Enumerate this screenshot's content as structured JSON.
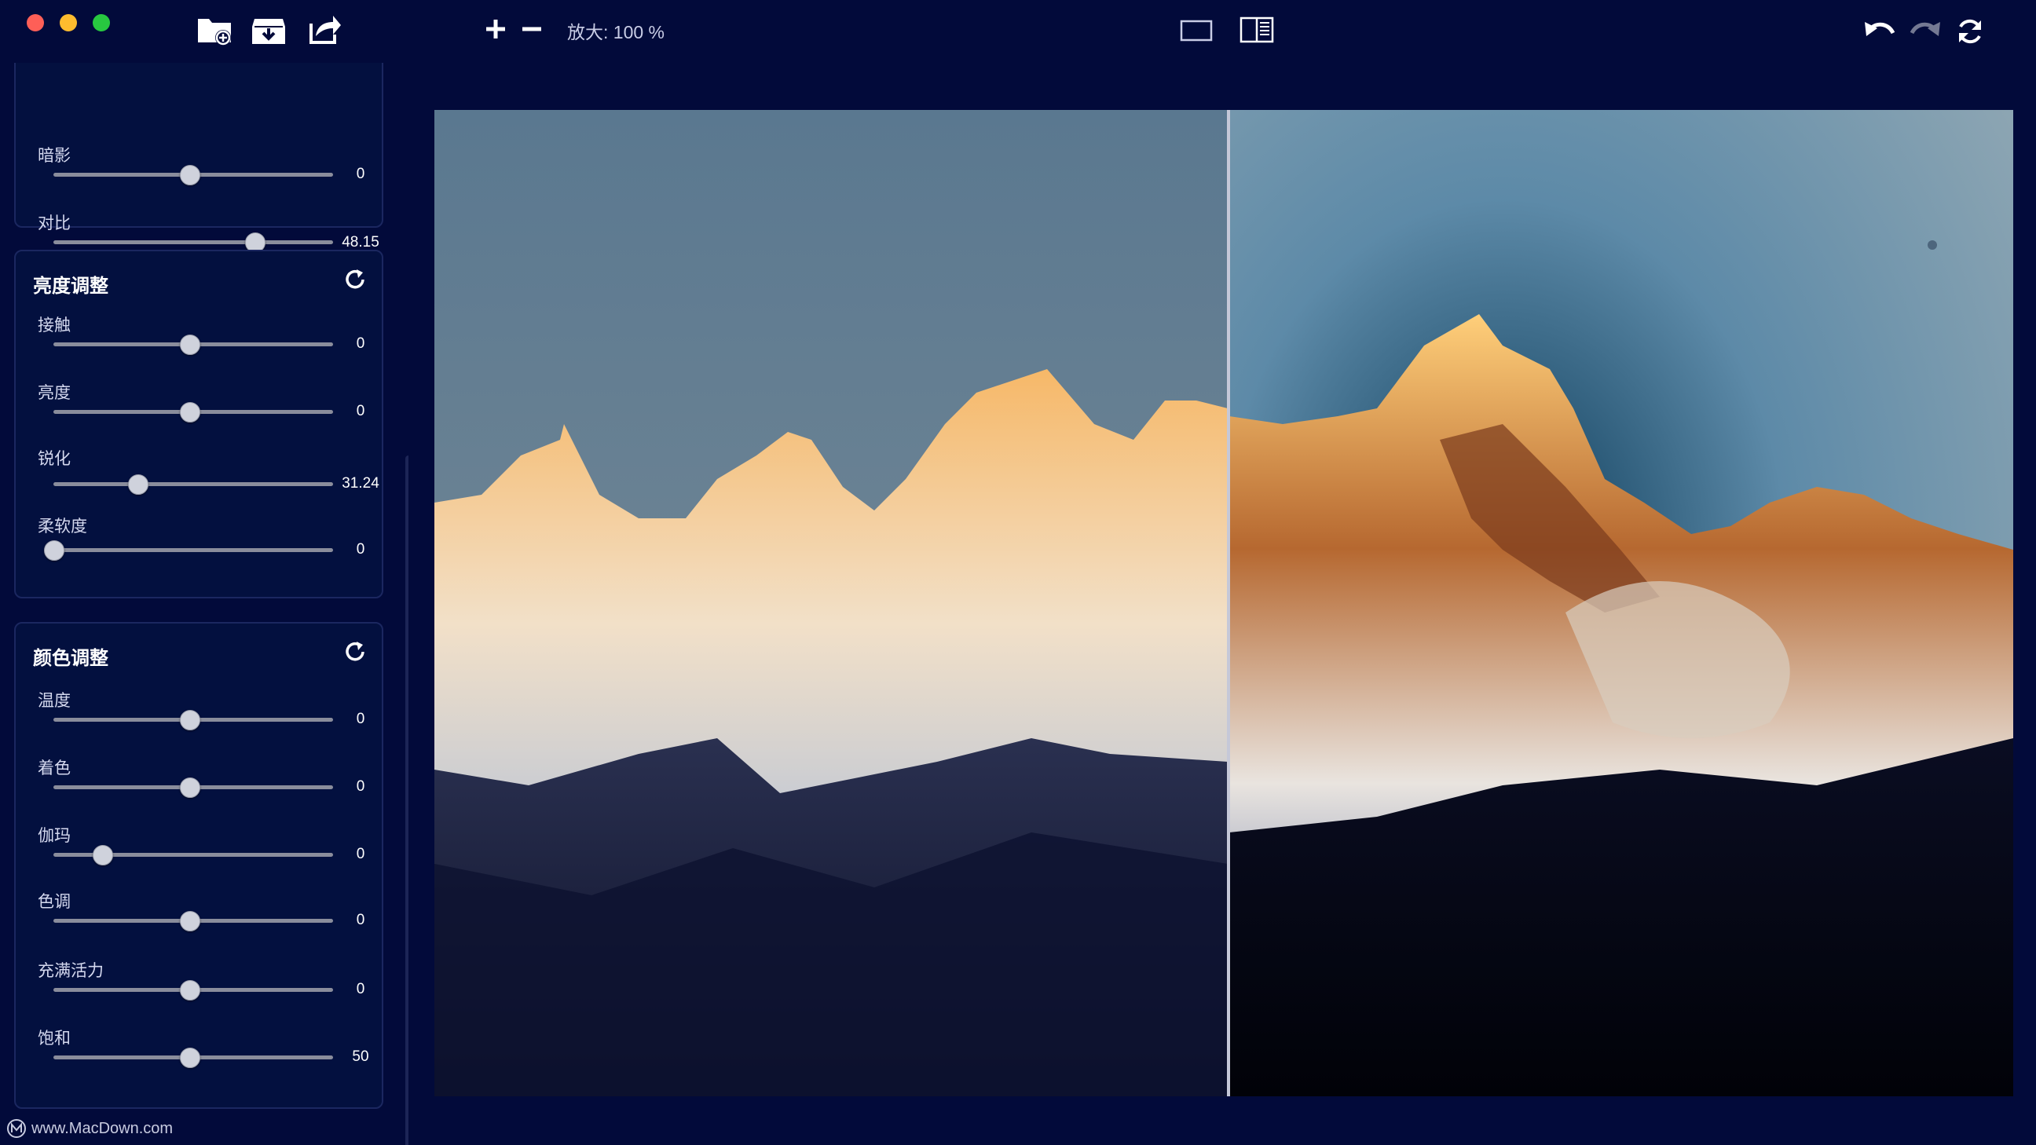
{
  "toolbar": {
    "zoom_label": "放大: 100 %",
    "icons": [
      "add-folder-icon",
      "save-icon",
      "share-icon",
      "zoom-in-icon",
      "zoom-out-icon",
      "single-view-icon",
      "split-view-icon",
      "undo-icon",
      "redo-icon",
      "refresh-icon"
    ]
  },
  "panels": {
    "tone": {
      "sliders": [
        {
          "label": "暗影",
          "value": "0",
          "fraction": 0.5
        },
        {
          "label": "对比",
          "value": "48.15",
          "fraction": 0.74
        }
      ]
    },
    "brightness": {
      "title": "亮度调整",
      "sliders": [
        {
          "label": "接触",
          "value": "0",
          "fraction": 0.5
        },
        {
          "label": "亮度",
          "value": "0",
          "fraction": 0.5
        },
        {
          "label": "锐化",
          "value": "31.24",
          "fraction": 0.31
        },
        {
          "label": "柔软度",
          "value": "0",
          "fraction": 0.0
        }
      ]
    },
    "color": {
      "title": "颜色调整",
      "sliders": [
        {
          "label": "温度",
          "value": "0",
          "fraction": 0.5
        },
        {
          "label": "着色",
          "value": "0",
          "fraction": 0.5
        },
        {
          "label": "伽玛",
          "value": "0",
          "fraction": 0.18
        },
        {
          "label": "色调",
          "value": "0",
          "fraction": 0.5
        },
        {
          "label": "充满活力",
          "value": "0",
          "fraction": 0.5
        },
        {
          "label": "饱和",
          "value": "50",
          "fraction": 0.5
        }
      ]
    }
  },
  "watermark": "www.MacDown.com",
  "colors": {
    "background": "#020a3a",
    "panel_bg": "#03103f",
    "panel_border": "#1b2760",
    "traffic_red": "#fe5f57",
    "traffic_yellow": "#febc2e",
    "traffic_green": "#28c840"
  }
}
